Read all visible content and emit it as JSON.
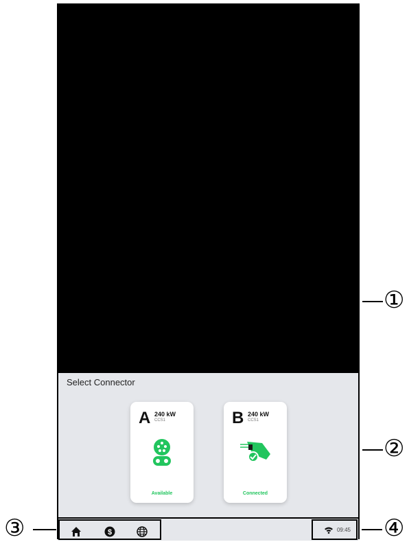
{
  "panel": {
    "title": "Select Connector"
  },
  "connectors": [
    {
      "letter": "A",
      "power": "240 kW",
      "type": "CCS1",
      "status": "Available",
      "icon": "ccs1-socket-icon"
    },
    {
      "letter": "B",
      "power": "240 kW",
      "type": "CCS1",
      "status": "Connected",
      "icon": "plugged-connector-icon"
    }
  ],
  "taskbar": {
    "icons": [
      "home-icon",
      "dollar-icon",
      "globe-icon"
    ],
    "time": "09:45",
    "wifi_icon": "wifi-icon"
  },
  "callouts": [
    "①",
    "②",
    "③",
    "④"
  ],
  "colors": {
    "accent_green": "#22c55e",
    "panel_bg": "#e5e7eb",
    "black_area": "#000000"
  }
}
